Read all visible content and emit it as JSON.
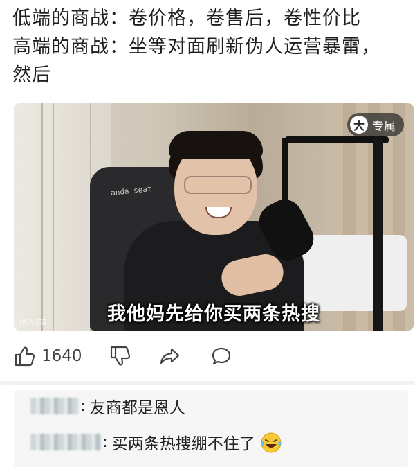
{
  "post": {
    "lines": [
      "低端的商战：卷价格，卷售后，卷性价比",
      "高端的商战：坐等对面刷新伪人运营暴雷，",
      "然后"
    ]
  },
  "video": {
    "badge_icon_char": "大",
    "badge_label": "专属",
    "chair_brand": "anda seat",
    "subtitle": "我他妈先给你买两条热搜",
    "watermark": "X的人选音"
  },
  "actions": {
    "like_count": "1640"
  },
  "comments": [
    {
      "sep": ":",
      "text": "友商都是恩人",
      "emoji": ""
    },
    {
      "sep": ":",
      "text": "买两条热搜绷不住了",
      "emoji": "laughing-tears-emoji"
    }
  ],
  "colors": {
    "icon_gray": "#444444",
    "comment_bg": "#f6f6f6"
  }
}
